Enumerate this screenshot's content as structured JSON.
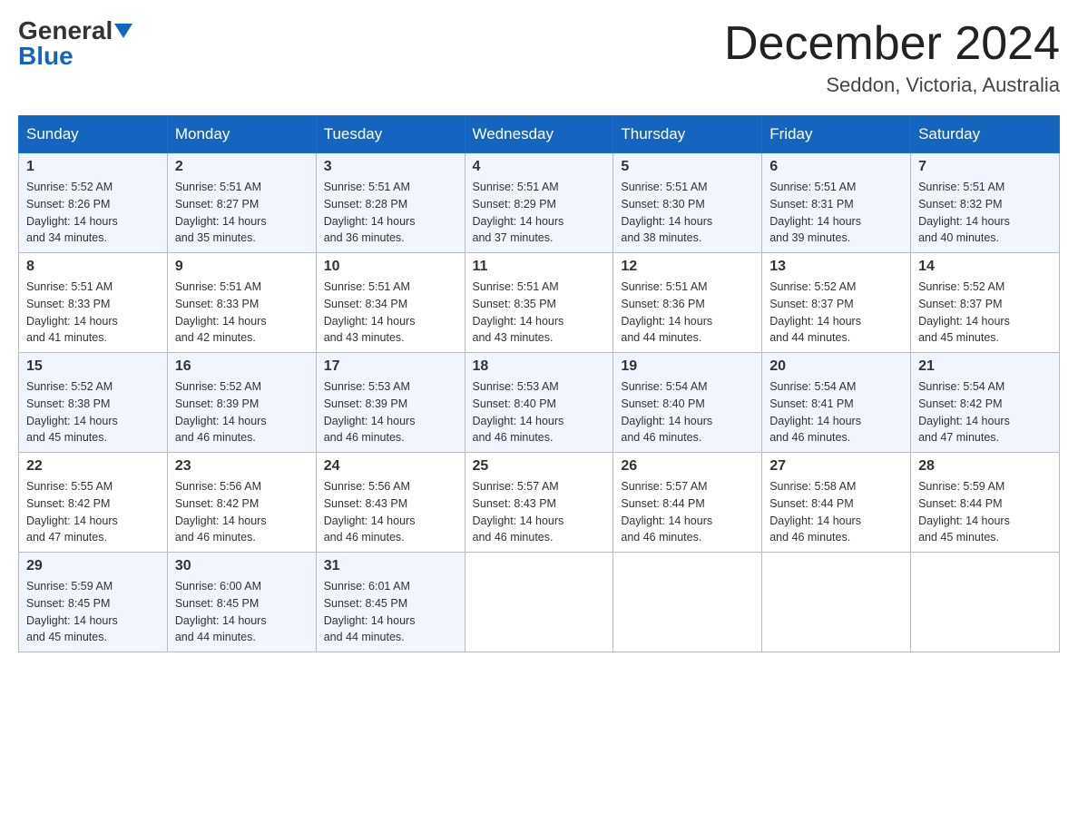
{
  "header": {
    "logo_general": "General",
    "logo_blue": "Blue",
    "month_title": "December 2024",
    "location": "Seddon, Victoria, Australia"
  },
  "days_of_week": [
    "Sunday",
    "Monday",
    "Tuesday",
    "Wednesday",
    "Thursday",
    "Friday",
    "Saturday"
  ],
  "weeks": [
    [
      {
        "day": "1",
        "sunrise": "5:52 AM",
        "sunset": "8:26 PM",
        "daylight": "14 hours and 34 minutes."
      },
      {
        "day": "2",
        "sunrise": "5:51 AM",
        "sunset": "8:27 PM",
        "daylight": "14 hours and 35 minutes."
      },
      {
        "day": "3",
        "sunrise": "5:51 AM",
        "sunset": "8:28 PM",
        "daylight": "14 hours and 36 minutes."
      },
      {
        "day": "4",
        "sunrise": "5:51 AM",
        "sunset": "8:29 PM",
        "daylight": "14 hours and 37 minutes."
      },
      {
        "day": "5",
        "sunrise": "5:51 AM",
        "sunset": "8:30 PM",
        "daylight": "14 hours and 38 minutes."
      },
      {
        "day": "6",
        "sunrise": "5:51 AM",
        "sunset": "8:31 PM",
        "daylight": "14 hours and 39 minutes."
      },
      {
        "day": "7",
        "sunrise": "5:51 AM",
        "sunset": "8:32 PM",
        "daylight": "14 hours and 40 minutes."
      }
    ],
    [
      {
        "day": "8",
        "sunrise": "5:51 AM",
        "sunset": "8:33 PM",
        "daylight": "14 hours and 41 minutes."
      },
      {
        "day": "9",
        "sunrise": "5:51 AM",
        "sunset": "8:33 PM",
        "daylight": "14 hours and 42 minutes."
      },
      {
        "day": "10",
        "sunrise": "5:51 AM",
        "sunset": "8:34 PM",
        "daylight": "14 hours and 43 minutes."
      },
      {
        "day": "11",
        "sunrise": "5:51 AM",
        "sunset": "8:35 PM",
        "daylight": "14 hours and 43 minutes."
      },
      {
        "day": "12",
        "sunrise": "5:51 AM",
        "sunset": "8:36 PM",
        "daylight": "14 hours and 44 minutes."
      },
      {
        "day": "13",
        "sunrise": "5:52 AM",
        "sunset": "8:37 PM",
        "daylight": "14 hours and 44 minutes."
      },
      {
        "day": "14",
        "sunrise": "5:52 AM",
        "sunset": "8:37 PM",
        "daylight": "14 hours and 45 minutes."
      }
    ],
    [
      {
        "day": "15",
        "sunrise": "5:52 AM",
        "sunset": "8:38 PM",
        "daylight": "14 hours and 45 minutes."
      },
      {
        "day": "16",
        "sunrise": "5:52 AM",
        "sunset": "8:39 PM",
        "daylight": "14 hours and 46 minutes."
      },
      {
        "day": "17",
        "sunrise": "5:53 AM",
        "sunset": "8:39 PM",
        "daylight": "14 hours and 46 minutes."
      },
      {
        "day": "18",
        "sunrise": "5:53 AM",
        "sunset": "8:40 PM",
        "daylight": "14 hours and 46 minutes."
      },
      {
        "day": "19",
        "sunrise": "5:54 AM",
        "sunset": "8:40 PM",
        "daylight": "14 hours and 46 minutes."
      },
      {
        "day": "20",
        "sunrise": "5:54 AM",
        "sunset": "8:41 PM",
        "daylight": "14 hours and 46 minutes."
      },
      {
        "day": "21",
        "sunrise": "5:54 AM",
        "sunset": "8:42 PM",
        "daylight": "14 hours and 47 minutes."
      }
    ],
    [
      {
        "day": "22",
        "sunrise": "5:55 AM",
        "sunset": "8:42 PM",
        "daylight": "14 hours and 47 minutes."
      },
      {
        "day": "23",
        "sunrise": "5:56 AM",
        "sunset": "8:42 PM",
        "daylight": "14 hours and 46 minutes."
      },
      {
        "day": "24",
        "sunrise": "5:56 AM",
        "sunset": "8:43 PM",
        "daylight": "14 hours and 46 minutes."
      },
      {
        "day": "25",
        "sunrise": "5:57 AM",
        "sunset": "8:43 PM",
        "daylight": "14 hours and 46 minutes."
      },
      {
        "day": "26",
        "sunrise": "5:57 AM",
        "sunset": "8:44 PM",
        "daylight": "14 hours and 46 minutes."
      },
      {
        "day": "27",
        "sunrise": "5:58 AM",
        "sunset": "8:44 PM",
        "daylight": "14 hours and 46 minutes."
      },
      {
        "day": "28",
        "sunrise": "5:59 AM",
        "sunset": "8:44 PM",
        "daylight": "14 hours and 45 minutes."
      }
    ],
    [
      {
        "day": "29",
        "sunrise": "5:59 AM",
        "sunset": "8:45 PM",
        "daylight": "14 hours and 45 minutes."
      },
      {
        "day": "30",
        "sunrise": "6:00 AM",
        "sunset": "8:45 PM",
        "daylight": "14 hours and 44 minutes."
      },
      {
        "day": "31",
        "sunrise": "6:01 AM",
        "sunset": "8:45 PM",
        "daylight": "14 hours and 44 minutes."
      },
      null,
      null,
      null,
      null
    ]
  ],
  "labels": {
    "sunrise": "Sunrise:",
    "sunset": "Sunset:",
    "daylight": "Daylight:"
  }
}
